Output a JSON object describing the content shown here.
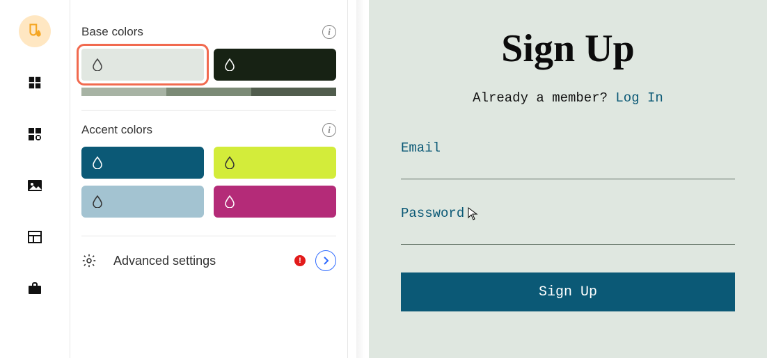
{
  "panel": {
    "base_colors_title": "Base colors",
    "accent_colors_title": "Accent colors",
    "advanced_label": "Advanced settings",
    "base_swatches": [
      {
        "color": "#e1e7e1",
        "icon": "#444",
        "selected": true
      },
      {
        "color": "#172214",
        "icon": "#fff",
        "selected": false
      }
    ],
    "base_gradient": [
      "#a7b3a4",
      "#7b8a76",
      "#515d4d"
    ],
    "accent_swatches": [
      {
        "color": "#0b5976",
        "icon": "#fff"
      },
      {
        "color": "#d3ec3a",
        "icon": "#333"
      },
      {
        "color": "#a3c3d1",
        "icon": "#333"
      },
      {
        "color": "#b42b78",
        "icon": "#fff"
      }
    ]
  },
  "preview": {
    "title": "Sign Up",
    "subline_text": "Already a member? ",
    "subline_link": "Log In",
    "email_label": "Email",
    "password_label": "Password",
    "button_label": "Sign Up"
  }
}
